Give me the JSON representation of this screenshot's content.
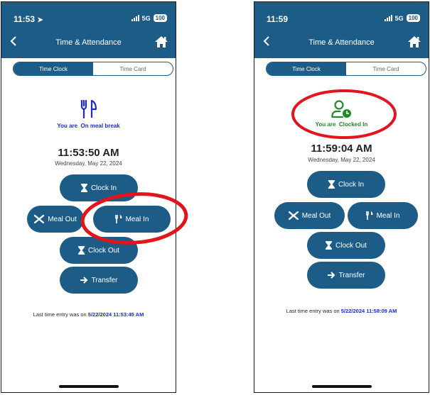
{
  "colors": {
    "header_bg": "#1c5c86",
    "button_bg": "#1c5c86",
    "status_blue": "#1d2bd1",
    "status_green": "#1e8a2c",
    "annotation_red": "#e3141b"
  },
  "screens": [
    {
      "status_time": "11:53",
      "network": "5G",
      "battery": "100",
      "header_title": "Time & Attendance",
      "tabs": [
        "Time Clock",
        "Time Card"
      ],
      "state_icon": "fork-knife-icon",
      "state_prefix": "You are",
      "state_text": "On meal break",
      "clock_time": "11:53:50 AM",
      "clock_date": "Wednesday, May 22, 2024",
      "buttons": {
        "clock_in": "Clock In",
        "meal_out": "Meal Out",
        "meal_in": "Meal In",
        "clock_out": "Clock Out",
        "transfer": "Transfer"
      },
      "last_entry_prefix": "Last time entry was on",
      "last_entry_value": "5/22/2024 11:53:45 AM"
    },
    {
      "status_time": "11:59",
      "network": "5G",
      "battery": "100",
      "header_title": "Time & Attendance",
      "tabs": [
        "Time Clock",
        "Time Card"
      ],
      "state_icon": "user-clock-icon",
      "state_prefix": "You are",
      "state_text": "Clocked In",
      "clock_time": "11:59:04 AM",
      "clock_date": "Wednesday, May 22, 2024",
      "buttons": {
        "clock_in": "Clock In",
        "meal_out": "Meal Out",
        "meal_in": "Meal In",
        "clock_out": "Clock Out",
        "transfer": "Transfer"
      },
      "last_entry_prefix": "Last time entry was on",
      "last_entry_value": "5/22/2024 11:58:09 AM"
    }
  ]
}
